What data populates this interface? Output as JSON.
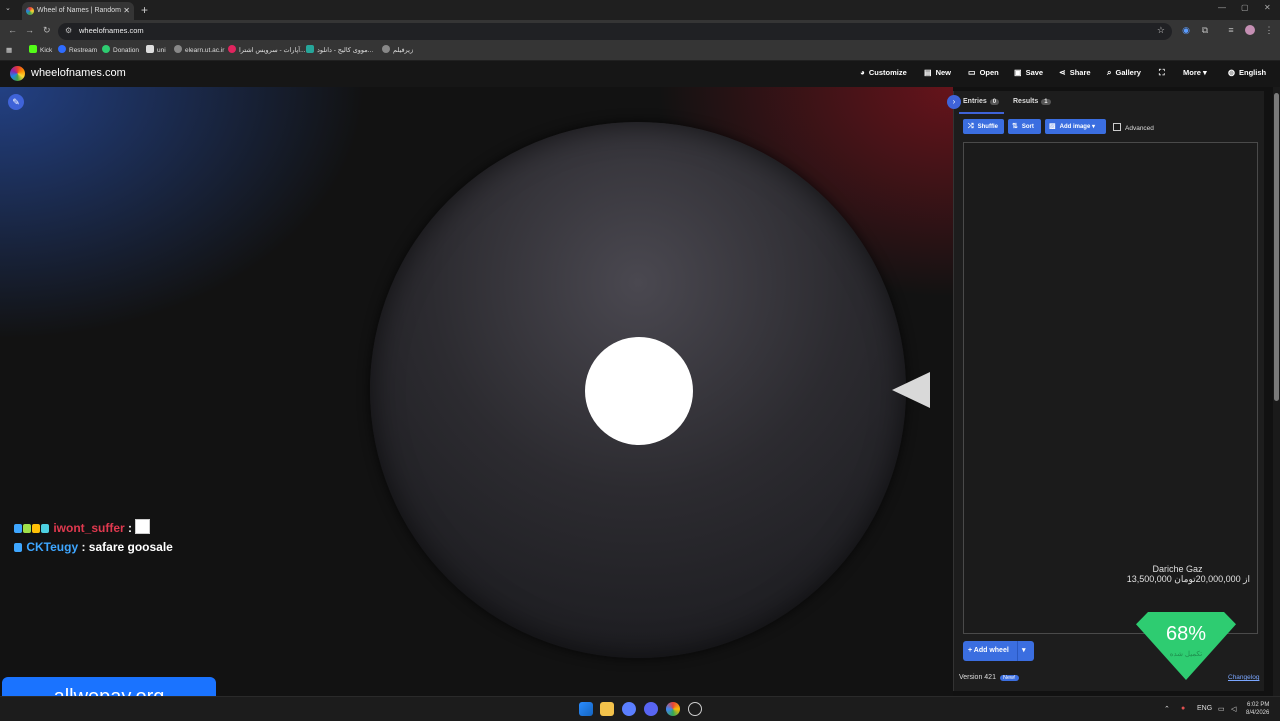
{
  "browser": {
    "tab_title": "Wheel of Names | Random nam",
    "url": "wheelofnames.com",
    "bookmarks": [
      "Kick",
      "Restream",
      "Donation",
      "uni",
      "elearn.ut.ac.ir",
      "آپارات - سرویس اشترا...",
      "مووی کالیج - دانلود...",
      "زیرفیلم"
    ]
  },
  "app": {
    "brand": "wheelofnames.com",
    "menu": [
      "Customize",
      "New",
      "Open",
      "Save",
      "Share",
      "Gallery",
      "",
      "More",
      "English"
    ]
  },
  "chat": [
    {
      "user": "iwont_suffer",
      "sep": " :",
      "message": "",
      "user_color": "#e0394f"
    },
    {
      "user": "CKTeugy",
      "sep": " : ",
      "message": "safare goosale",
      "user_color": "#3ea6ff"
    }
  ],
  "promo": {
    "text": "allwepay.org"
  },
  "panel": {
    "tabs": [
      {
        "label": "Entries",
        "count": "0"
      },
      {
        "label": "Results",
        "count": "1"
      }
    ],
    "buttons": {
      "shuffle": "Shuffle",
      "sort": "Sort",
      "add_image": "Add image"
    },
    "advanced_label": "Advanced",
    "add_wheel": "Add wheel",
    "version": "Version 421",
    "version_badge": "New!",
    "changelog": "Changelog"
  },
  "product": {
    "name": "Dariche Gaz",
    "progress_text": "13,500,000 از 20,000,000تومان",
    "percent": "68%",
    "percent_sub": "تکمیل شده"
  },
  "taskbar": {
    "lang": "ENG",
    "time": "6:02 PM",
    "date": "8/4/2026"
  },
  "colors": {
    "accent": "#3b6ee0",
    "shield": "#2ecc71",
    "promo": "#1a73ff"
  }
}
